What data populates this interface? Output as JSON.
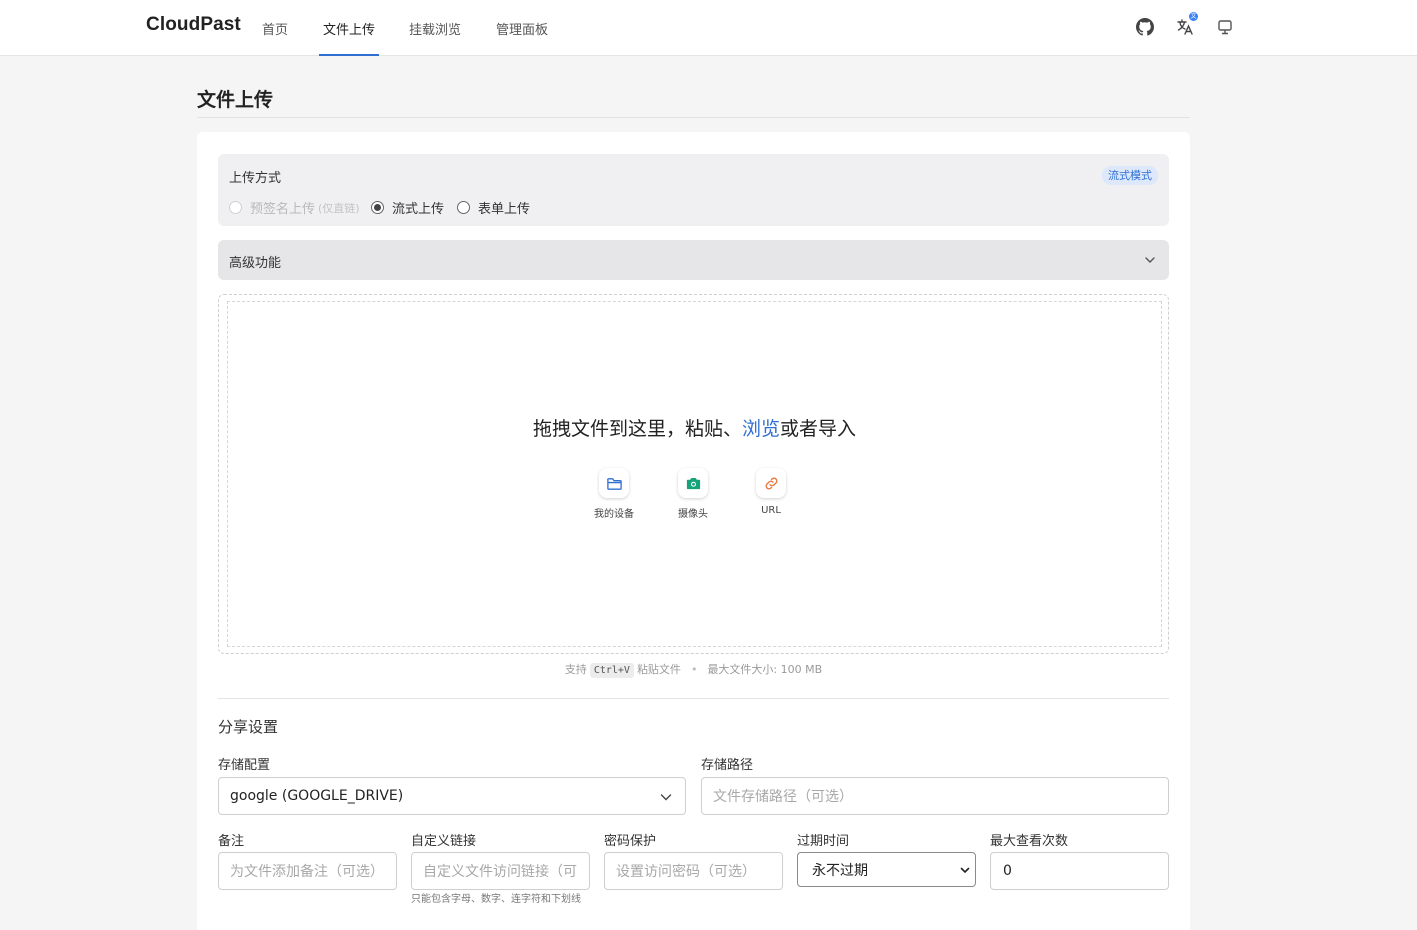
{
  "brand": "CloudPast",
  "nav": {
    "items": [
      {
        "label": "首页",
        "active": false
      },
      {
        "label": "文件上传",
        "active": true
      },
      {
        "label": "挂载浏览",
        "active": false
      },
      {
        "label": "管理面板",
        "active": false
      }
    ],
    "icons": [
      "github-icon",
      "translate-icon",
      "monitor-icon"
    ]
  },
  "page_title": "文件上传",
  "upload_method": {
    "label": "上传方式",
    "mode_badge": "流式模式",
    "options": [
      {
        "label": "预签名上传",
        "hint": "(仅直链)",
        "checked": false,
        "disabled": true
      },
      {
        "label": "流式上传",
        "checked": true,
        "disabled": false
      },
      {
        "label": "表单上传",
        "checked": false,
        "disabled": false
      }
    ]
  },
  "advanced": {
    "label": "高级功能"
  },
  "dropzone": {
    "text_before": "拖拽文件到这里，粘贴、",
    "browse_link": "浏览",
    "text_after": "或者导入",
    "sources": [
      {
        "label": "我的设备",
        "icon": "folder-icon"
      },
      {
        "label": "摄像头",
        "icon": "camera-icon"
      },
      {
        "label": "URL",
        "icon": "link-icon"
      }
    ]
  },
  "hint": {
    "support": "支持",
    "shortcut": "Ctrl+V",
    "paste": "粘贴文件",
    "bullet": "•",
    "max_size": "最大文件大小: 100 MB"
  },
  "share": {
    "title": "分享设置",
    "storage_config": {
      "label": "存储配置",
      "value": "google (GOOGLE_DRIVE)"
    },
    "storage_path": {
      "label": "存储路径",
      "placeholder": "文件存储路径（可选）"
    },
    "remark": {
      "label": "备注",
      "placeholder": "为文件添加备注（可选）"
    },
    "custom_link": {
      "label": "自定义链接",
      "placeholder": "自定义文件访问链接（可",
      "help": "只能包含字母、数字、连字符和下划线"
    },
    "password": {
      "label": "密码保护",
      "placeholder": "设置访问密码（可选）"
    },
    "expiry": {
      "label": "过期时间",
      "value": "永不过期"
    },
    "max_views": {
      "label": "最大查看次数",
      "value": "0"
    }
  },
  "colors": {
    "accent": "#2f6fd1",
    "badge_bg": "#dde8fb"
  }
}
